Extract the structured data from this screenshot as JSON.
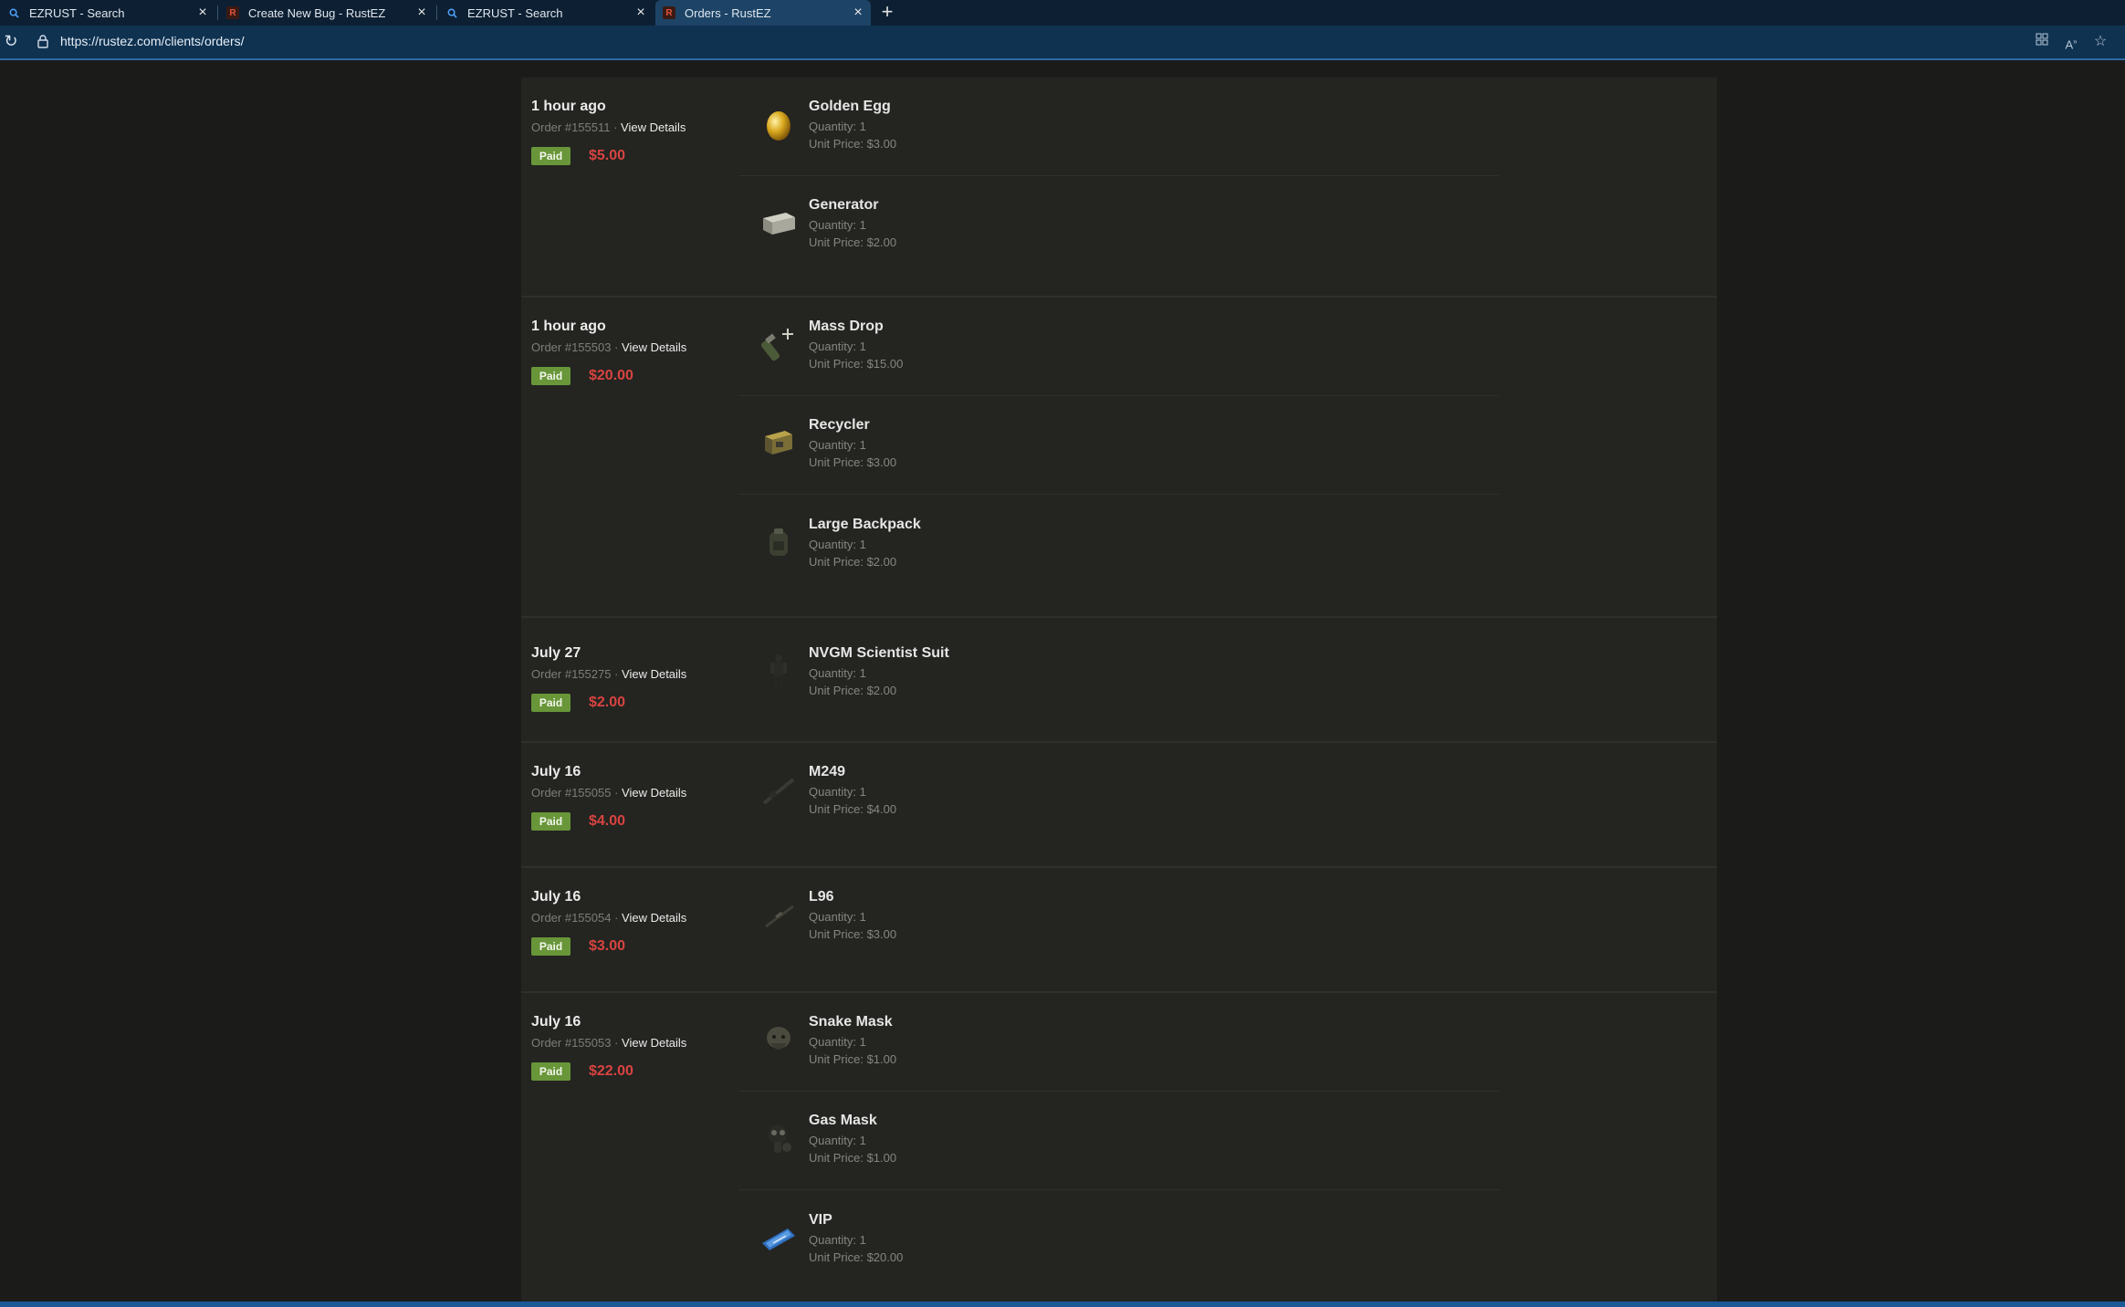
{
  "browser": {
    "tabs": [
      {
        "label": "EZRUST - Search",
        "icon": "search-icon"
      },
      {
        "label": "Create New Bug - RustEZ",
        "icon": "rustez-favicon"
      },
      {
        "label": "EZRUST - Search",
        "icon": "search-icon"
      },
      {
        "label": "Orders - RustEZ",
        "icon": "rustez-favicon",
        "active": true
      }
    ],
    "url": "https://rustez.com/clients/orders/"
  },
  "orders": [
    {
      "date": "1 hour ago",
      "order_label": "Order #155511 · ",
      "view_details": "View Details",
      "status": "Paid",
      "total": "$5.00",
      "items": [
        {
          "name": "Golden Egg",
          "quantity": "Quantity: 1",
          "unit_price": "Unit Price: $3.00",
          "icon": "golden-egg-icon"
        },
        {
          "name": "Generator",
          "quantity": "Quantity: 1",
          "unit_price": "Unit Price: $2.00",
          "icon": "generator-icon"
        }
      ]
    },
    {
      "date": "1 hour ago",
      "order_label": "Order #155503 · ",
      "view_details": "View Details",
      "status": "Paid",
      "total": "$20.00",
      "items": [
        {
          "name": "Mass Drop",
          "quantity": "Quantity: 1",
          "unit_price": "Unit Price: $15.00",
          "icon": "supply-signal-icon"
        },
        {
          "name": "Recycler",
          "quantity": "Quantity: 1",
          "unit_price": "Unit Price: $3.00",
          "icon": "recycler-icon"
        },
        {
          "name": "Large Backpack",
          "quantity": "Quantity: 1",
          "unit_price": "Unit Price: $2.00",
          "icon": "backpack-icon"
        }
      ]
    },
    {
      "date": "July 27",
      "order_label": "Order #155275 · ",
      "view_details": "View Details",
      "status": "Paid",
      "total": "$2.00",
      "items": [
        {
          "name": "NVGM Scientist Suit",
          "quantity": "Quantity: 1",
          "unit_price": "Unit Price: $2.00",
          "icon": "scientist-suit-icon"
        }
      ]
    },
    {
      "date": "July 16",
      "order_label": "Order #155055 · ",
      "view_details": "View Details",
      "status": "Paid",
      "total": "$4.00",
      "items": [
        {
          "name": "M249",
          "quantity": "Quantity: 1",
          "unit_price": "Unit Price: $4.00",
          "icon": "machine-gun-icon"
        }
      ]
    },
    {
      "date": "July 16",
      "order_label": "Order #155054 · ",
      "view_details": "View Details",
      "status": "Paid",
      "total": "$3.00",
      "items": [
        {
          "name": "L96",
          "quantity": "Quantity: 1",
          "unit_price": "Unit Price: $3.00",
          "icon": "sniper-rifle-icon"
        }
      ]
    },
    {
      "date": "July 16",
      "order_label": "Order #155053 · ",
      "view_details": "View Details",
      "status": "Paid",
      "total": "$22.00",
      "items": [
        {
          "name": "Snake Mask",
          "quantity": "Quantity: 1",
          "unit_price": "Unit Price: $1.00",
          "icon": "snake-mask-icon"
        },
        {
          "name": "Gas Mask",
          "quantity": "Quantity: 1",
          "unit_price": "Unit Price: $1.00",
          "icon": "gas-mask-icon"
        },
        {
          "name": "VIP",
          "quantity": "Quantity: 1",
          "unit_price": "Unit Price: $20.00",
          "icon": "vip-ticket-icon"
        }
      ]
    }
  ]
}
